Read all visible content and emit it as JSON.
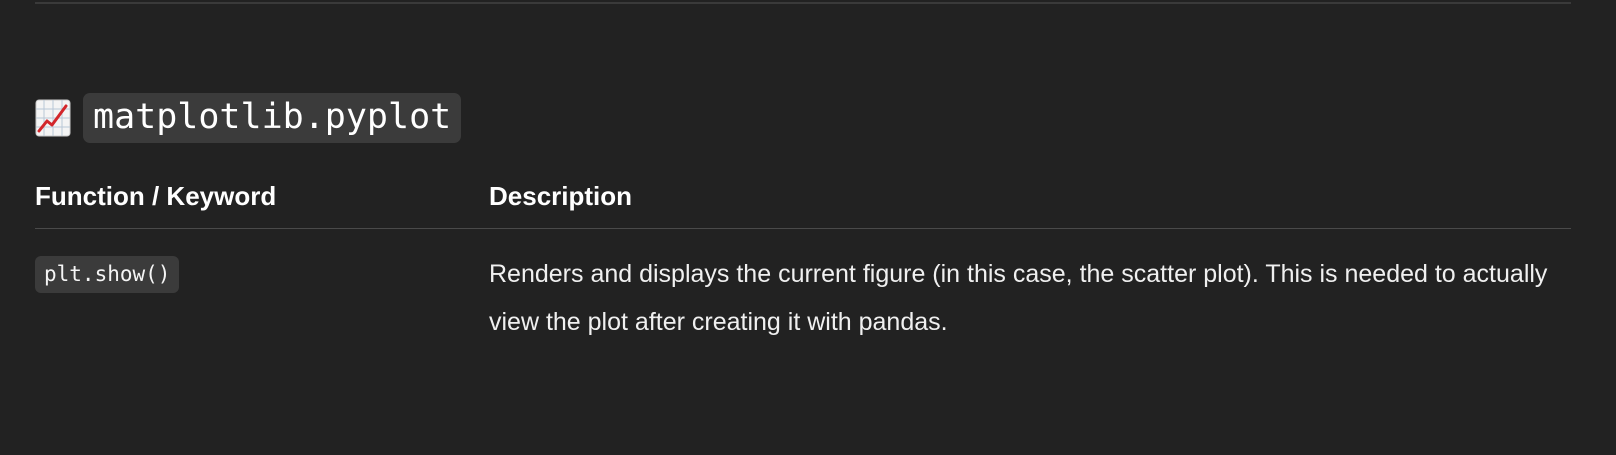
{
  "section": {
    "icon": "chart-increasing-emoji-icon",
    "title": "matplotlib.pyplot"
  },
  "table": {
    "headers": [
      "Function / Keyword",
      "Description"
    ],
    "rows": [
      {
        "function": "plt.show()",
        "description": "Renders and displays the current figure (in this case, the scatter plot). This is needed to actually view the plot after creating it with pandas."
      }
    ]
  },
  "colors": {
    "background": "#222222",
    "code_background": "#3b3b3b",
    "rule": "#4a4a4a"
  }
}
